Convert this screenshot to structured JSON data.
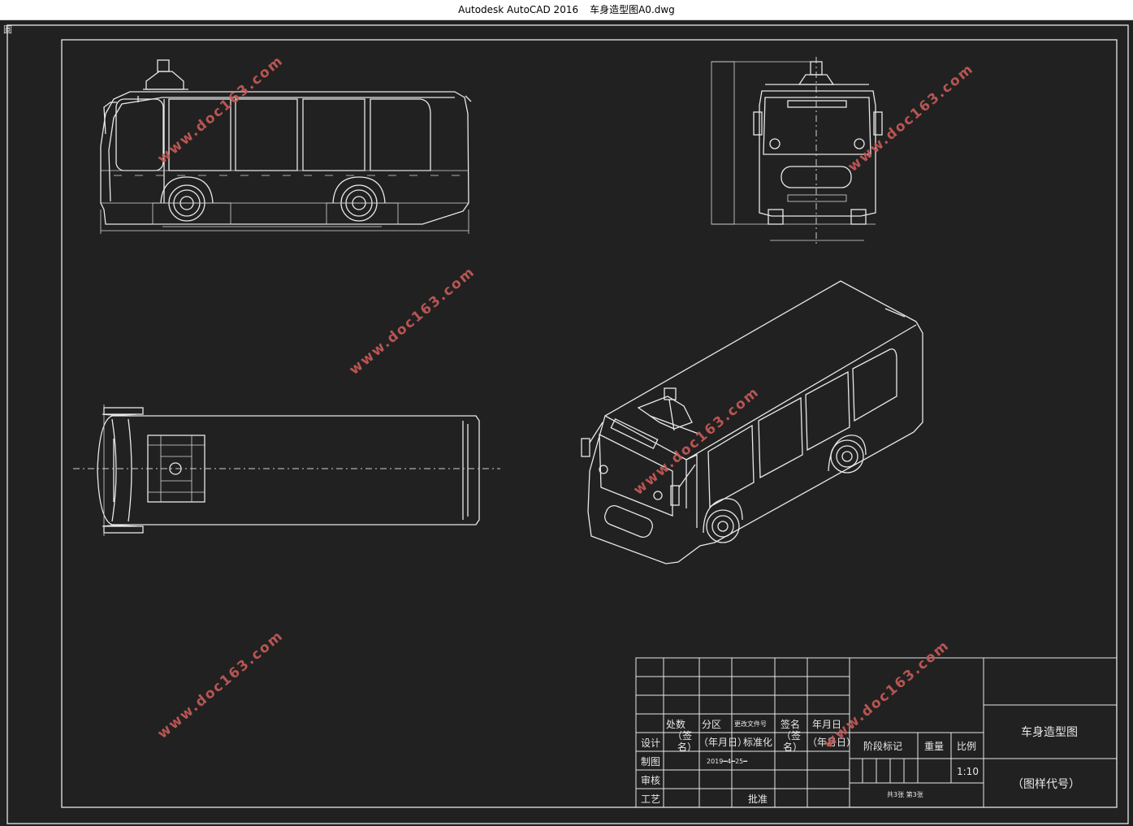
{
  "window": {
    "app_title": "Autodesk AutoCAD 2016",
    "file_name": "车身造型图A0.dwg",
    "system_menu_glyph": "圓"
  },
  "watermark": "www.doc163.com",
  "title_block": {
    "drawing_name": "车身造型图",
    "drawing_code": "（图样代号）",
    "revision_headers": {
      "count": "处数",
      "zone": "分区",
      "doc_no": "更改文件号",
      "signature": "签名",
      "date": "年月日"
    },
    "rows": {
      "design": "设计",
      "sign_a": "（签",
      "sign_b": "名）",
      "date_paren": "（年月日）",
      "standardize": "标准化",
      "sign2_a": "（签",
      "sign2_b": "名）",
      "date2": "（年月日）",
      "drafting": "制图",
      "draft_date": "2019━4━25━",
      "review": "审核",
      "process": "工艺",
      "approve": "批准"
    },
    "stage_mark": "阶段标记",
    "weight": "重量",
    "scale_label": "比例",
    "scale_value": "1:10",
    "sheets": "共3张  第3张"
  },
  "colors": {
    "background": "#212121",
    "lines": "#e8e8e8",
    "watermark": "#c55a57",
    "titlebar": "#ffffff"
  }
}
